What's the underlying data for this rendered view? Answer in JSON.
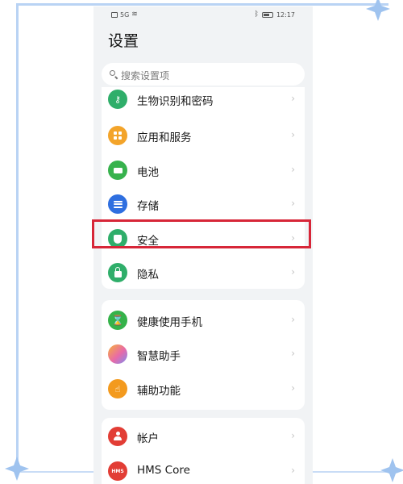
{
  "status_bar": {
    "left_text": "5G",
    "time": "12:17"
  },
  "page_title": "设置",
  "search": {
    "placeholder": "搜索设置项"
  },
  "groups": [
    {
      "items": [
        {
          "label": "生物识别和密码",
          "icon": "key-icon",
          "color": "#2fae6a"
        },
        {
          "label": "应用和服务",
          "icon": "apps-icon",
          "color": "#f3a42a"
        },
        {
          "label": "电池",
          "icon": "battery-icon",
          "color": "#37b24d"
        },
        {
          "label": "存储",
          "icon": "storage-icon",
          "color": "#2f6fe0"
        },
        {
          "label": "安全",
          "icon": "shield-icon",
          "color": "#2fae6a"
        },
        {
          "label": "隐私",
          "icon": "lock-icon",
          "color": "#2fae6a"
        }
      ]
    },
    {
      "items": [
        {
          "label": "健康使用手机",
          "icon": "hourglass-icon",
          "color": "#35b24a"
        },
        {
          "label": "智慧助手",
          "icon": "assistant-icon",
          "color": "#e86aa8"
        },
        {
          "label": "辅助功能",
          "icon": "hand-icon",
          "color": "#f39a1e"
        }
      ]
    },
    {
      "items": [
        {
          "label": "帐户",
          "icon": "person-icon",
          "color": "#e23d35"
        },
        {
          "label": "HMS Core",
          "icon": "hms-icon",
          "color": "#e23d35",
          "icon_text": "HMS"
        }
      ]
    }
  ],
  "highlighted_item": "安全",
  "colors": {
    "highlight_border": "#d72638",
    "frame": "#b9d3f4"
  }
}
